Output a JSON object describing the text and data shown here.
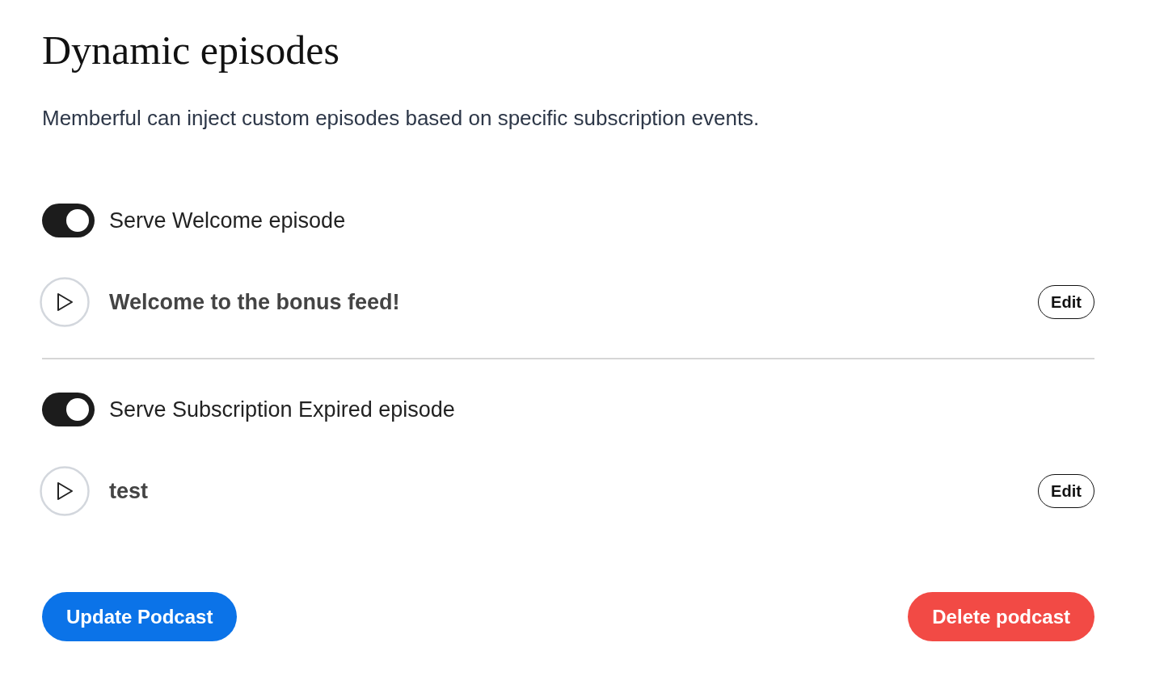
{
  "title": "Dynamic episodes",
  "description": "Memberful can inject custom episodes based on specific subscription events.",
  "sections": [
    {
      "toggle": {
        "label": "Serve Welcome episode",
        "on": true
      },
      "episode": {
        "title": "Welcome to the bonus feed!",
        "action": "Edit"
      }
    },
    {
      "toggle": {
        "label": "Serve Subscription Expired episode",
        "on": true
      },
      "episode": {
        "title": "test",
        "action": "Edit"
      }
    }
  ],
  "buttons": [
    {
      "label": "Update Podcast",
      "kind": "primary"
    },
    {
      "label": "Delete podcast",
      "kind": "danger"
    }
  ]
}
